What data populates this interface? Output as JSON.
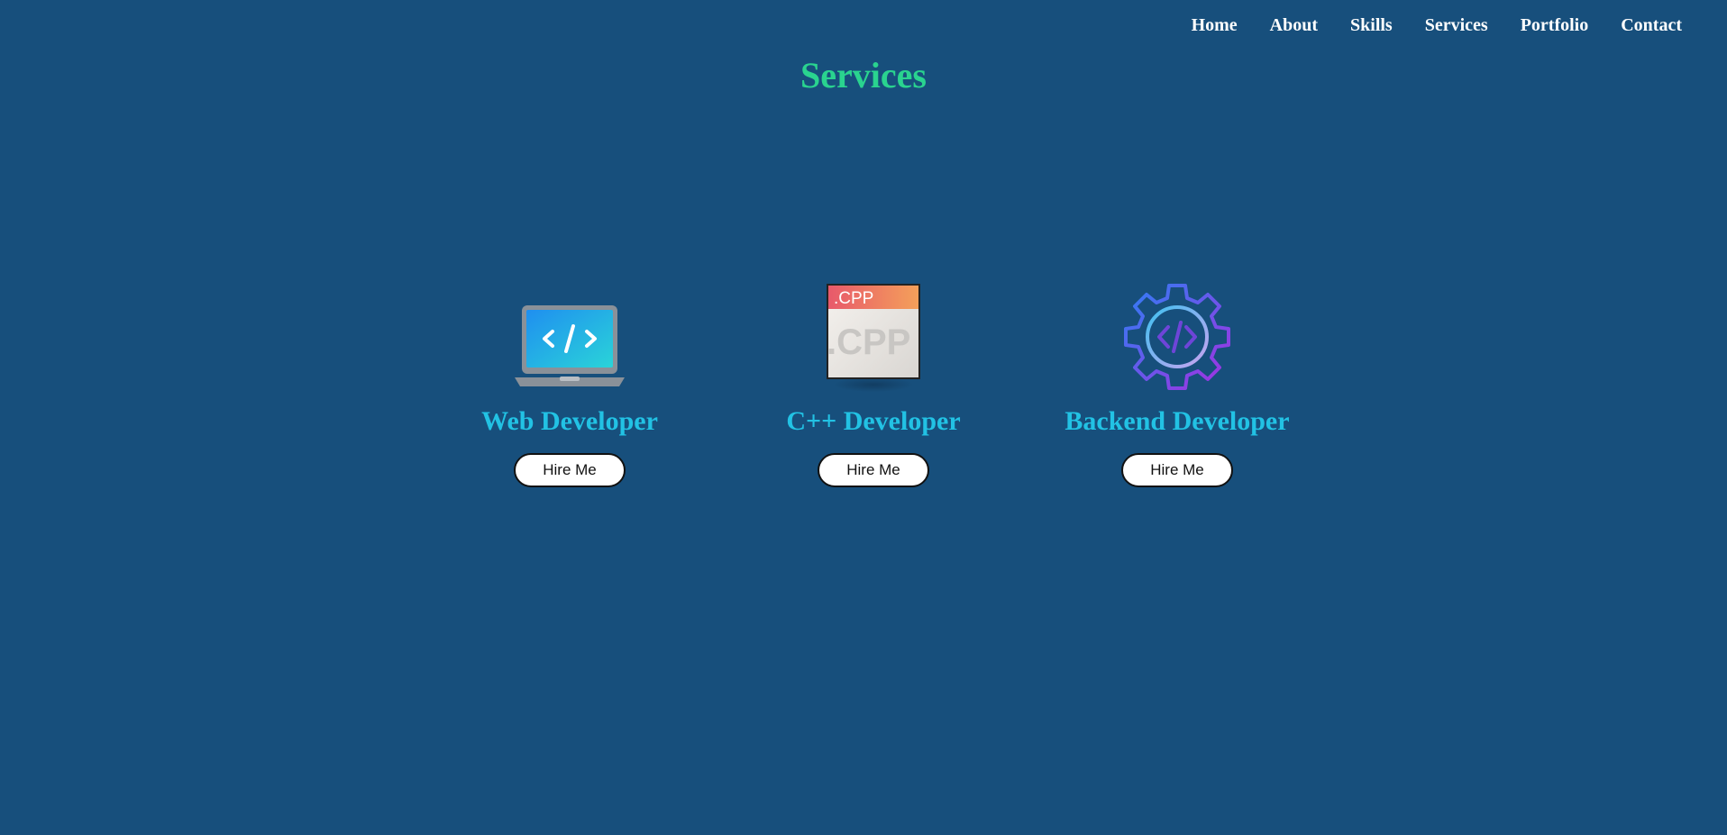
{
  "nav": {
    "items": [
      {
        "label": "Home"
      },
      {
        "label": "About"
      },
      {
        "label": "Skills"
      },
      {
        "label": "Services"
      },
      {
        "label": "Portfolio"
      },
      {
        "label": "Contact"
      }
    ]
  },
  "page": {
    "title": "Services"
  },
  "colors": {
    "background": "#174f7c",
    "title": "#2ad38f",
    "card_title": "#22c2e4",
    "nav_text": "#ffffff",
    "button_bg": "#ffffff"
  },
  "services": [
    {
      "title": "Web Developer",
      "button_label": "Hire Me",
      "icon": "laptop-code-icon"
    },
    {
      "title": "C++ Developer",
      "button_label": "Hire Me",
      "icon": "cpp-file-icon",
      "icon_text": ".CPP"
    },
    {
      "title": "Backend Developer",
      "button_label": "Hire Me",
      "icon": "gear-code-icon"
    }
  ]
}
